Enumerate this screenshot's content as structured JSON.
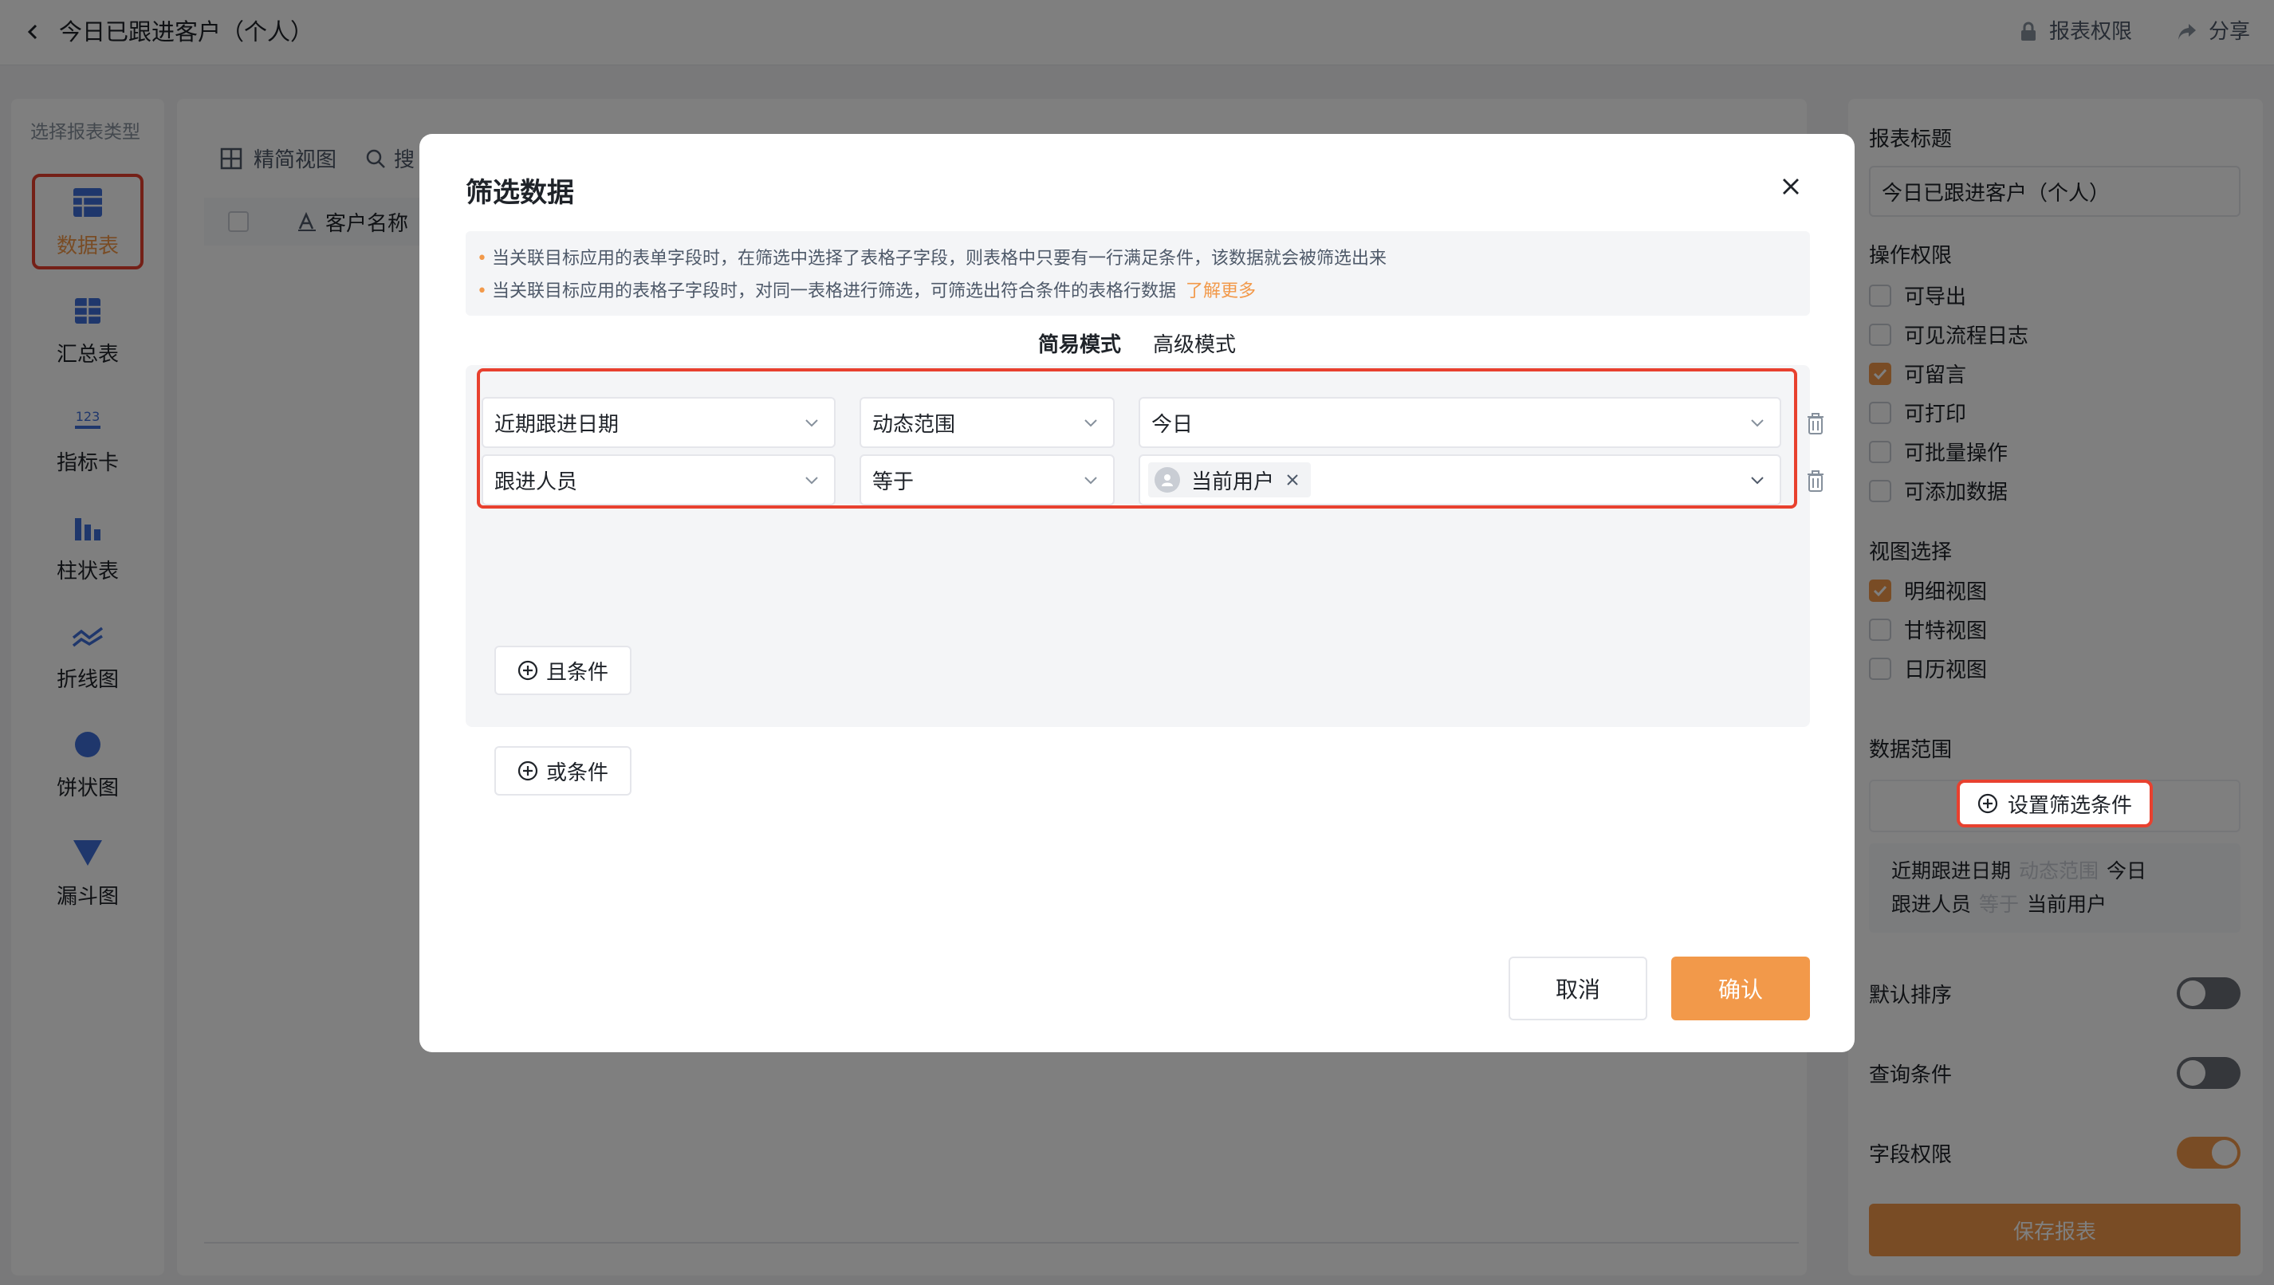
{
  "header": {
    "title": "今日已跟进客户（个人）",
    "report_permission": "报表权限",
    "share": "分享"
  },
  "left_panel": {
    "title": "选择报表类型",
    "types": [
      {
        "label": "数据表",
        "icon": "table-icon",
        "active": true
      },
      {
        "label": "汇总表",
        "icon": "summary-table-icon",
        "active": false
      },
      {
        "label": "指标卡",
        "icon": "metric-card-icon",
        "active": false
      },
      {
        "label": "柱状表",
        "icon": "bar-chart-icon",
        "active": false
      },
      {
        "label": "折线图",
        "icon": "line-chart-icon",
        "active": false
      },
      {
        "label": "饼状图",
        "icon": "pie-chart-icon",
        "active": false
      },
      {
        "label": "漏斗图",
        "icon": "funnel-chart-icon",
        "active": false
      }
    ]
  },
  "main": {
    "view_mode": "精简视图",
    "search_peek": "搜",
    "column_customer": "客户名称"
  },
  "right_panel": {
    "report_title_label": "报表标题",
    "report_title_value": "今日已跟进客户（个人）",
    "permissions_label": "操作权限",
    "permissions": [
      {
        "label": "可导出",
        "checked": false
      },
      {
        "label": "可见流程日志",
        "checked": false
      },
      {
        "label": "可留言",
        "checked": true
      },
      {
        "label": "可打印",
        "checked": false
      },
      {
        "label": "可批量操作",
        "checked": false
      },
      {
        "label": "可添加数据",
        "checked": false
      }
    ],
    "view_label": "视图选择",
    "views": [
      {
        "label": "明细视图",
        "checked": true
      },
      {
        "label": "甘特视图",
        "checked": false
      },
      {
        "label": "日历视图",
        "checked": false
      }
    ],
    "data_range_label": "数据范围",
    "set_filter": "设置筛选条件",
    "summary": [
      {
        "field": "近期跟进日期",
        "op": "动态范围",
        "value": "今日"
      },
      {
        "field": "跟进人员",
        "op": "等于",
        "value": "当前用户"
      }
    ],
    "toggles": [
      {
        "label": "默认排序",
        "on": false
      },
      {
        "label": "查询条件",
        "on": false
      },
      {
        "label": "字段权限",
        "on": true
      }
    ],
    "save": "保存报表"
  },
  "modal": {
    "title": "筛选数据",
    "notice_1": "当关联目标应用的表单字段时，在筛选中选择了表格子字段，则表格中只要有一行满足条件，该数据就会被筛选出来",
    "notice_2": "当关联目标应用的表格子字段时，对同一表格进行筛选，可筛选出符合条件的表格行数据",
    "learn_more": "了解更多",
    "mode_simple": "简易模式",
    "mode_advanced": "高级模式",
    "conditions": [
      {
        "field": "近期跟进日期",
        "op": "动态范围",
        "value": "今日"
      },
      {
        "field": "跟进人员",
        "op": "等于",
        "value": "当前用户"
      }
    ],
    "and_condition": "且条件",
    "or_condition": "或条件",
    "cancel": "取消",
    "confirm": "确认"
  },
  "colors": {
    "accent": "#f2994a",
    "highlight": "#e8412f"
  }
}
